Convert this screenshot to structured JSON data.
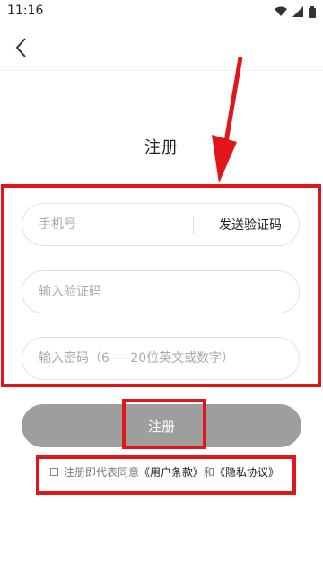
{
  "status_bar": {
    "time": "11:16"
  },
  "header": {
    "back_icon": "back-arrow-icon"
  },
  "page": {
    "title": "注册"
  },
  "form": {
    "phone_placeholder": "手机号",
    "send_code_label": "发送验证码",
    "code_placeholder": "输入验证码",
    "password_placeholder": "输入密码（6−−20位英文或数字）"
  },
  "register_button": {
    "label": "注册",
    "color": "#9e9e9e"
  },
  "agreement": {
    "prefix": "注册即代表同意",
    "terms_link": "《用户条款》",
    "and": "和",
    "privacy_link": "《隐私协议》"
  },
  "annotation_color": "#e1161b"
}
